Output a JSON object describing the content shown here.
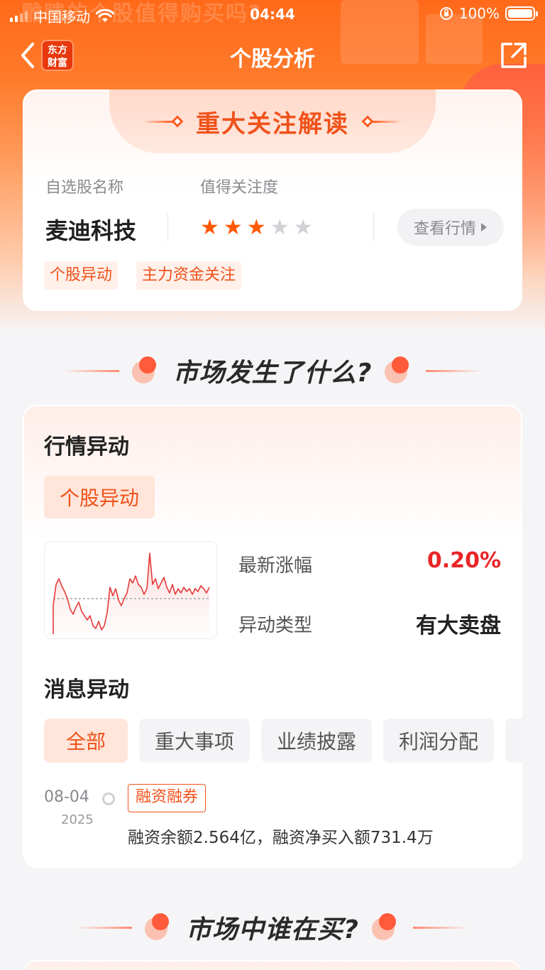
{
  "status_bar": {
    "carrier": "中国移动",
    "time": "04:44",
    "battery": "100%"
  },
  "banner": {
    "ghost_text": "雕睛的个股值得购买吗?"
  },
  "nav": {
    "title": "个股分析",
    "logo_line1": "东方",
    "logo_line2": "财富"
  },
  "focus_card": {
    "title": "重大关注解读",
    "name_label": "自选股名称",
    "attention_label": "值得关注度",
    "stock_name": "麦迪科技",
    "rating": 3,
    "rating_max": 5,
    "view_button": "查看行情",
    "tags": [
      "个股异动",
      "主力资金关注"
    ]
  },
  "section1": {
    "title": "市场发生了什么?"
  },
  "anomaly_card": {
    "title": "行情异动",
    "tab": "个股异动",
    "latest_change_label": "最新涨幅",
    "latest_change_value": "0.20%",
    "type_label": "异动类型",
    "type_value": "有大卖盘",
    "news_title": "消息异动",
    "filters": [
      "全部",
      "重大事项",
      "业绩披露",
      "利润分配"
    ],
    "news": [
      {
        "date": "08-04",
        "year": "2025",
        "tag": "融资融券",
        "text": "融资余额2.564亿，融资净买入额731.4万"
      }
    ]
  },
  "section2": {
    "title": "市场中谁在买?"
  },
  "colors": {
    "brand": "#ff6a1a",
    "accent": "#f0521a",
    "up_red": "#ea2427"
  }
}
